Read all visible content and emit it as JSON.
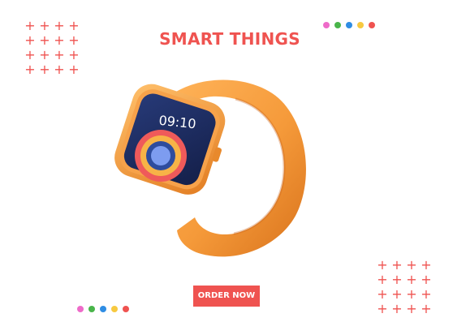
{
  "headline": "SMART THINGS",
  "watch": {
    "time": "09:10"
  },
  "order_button": {
    "label": "ORDER NOW"
  },
  "colors": {
    "accent": "#ef5350",
    "strap": "#f59a3a",
    "screen": "#1d2b5e"
  },
  "decor": {
    "dots_top_right": [
      "#ee6bc9",
      "#49b54a",
      "#2f8de4",
      "#f7c940",
      "#ef5350"
    ],
    "dots_bottom_left": [
      "#ee6bc9",
      "#49b54a",
      "#2f8de4",
      "#f7c940",
      "#ef5350"
    ]
  }
}
